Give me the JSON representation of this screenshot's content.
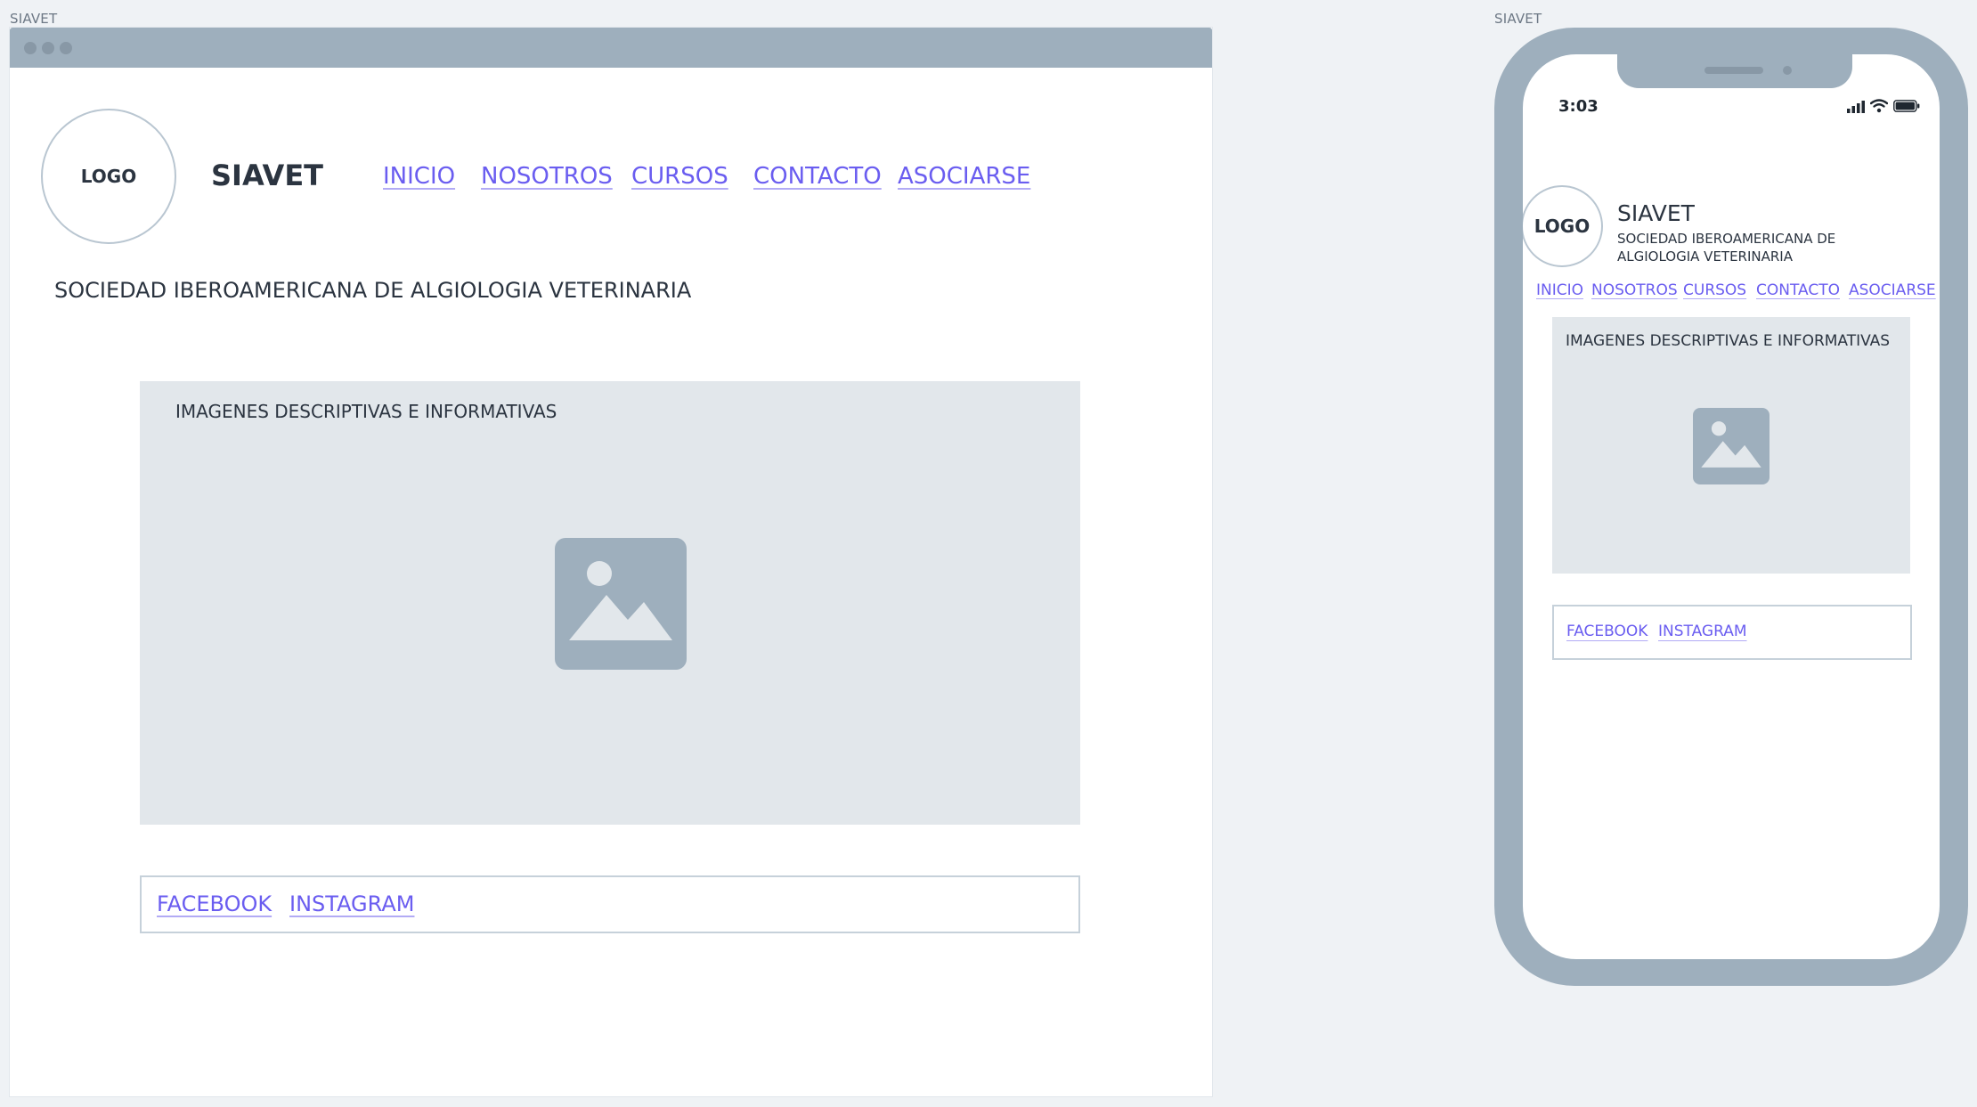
{
  "desktop": {
    "frame_label": "SIAVET",
    "logo_text": "LOGO",
    "brand": "SIAVET",
    "nav": [
      {
        "label": "INICIO"
      },
      {
        "label": "NOSOTROS"
      },
      {
        "label": "CURSOS"
      },
      {
        "label": "CONTACTO"
      },
      {
        "label": "ASOCIARSE"
      }
    ],
    "subtitle": "SOCIEDAD IBEROAMERICANA DE ALGIOLOGIA VETERINARIA",
    "image_panel_label": "IMAGENES DESCRIPTIVAS E INFORMATIVAS",
    "social": {
      "facebook": "FACEBOOK",
      "instagram": "INSTAGRAM"
    }
  },
  "mobile": {
    "frame_label": "SIAVET",
    "status_time": "3:03",
    "logo_text": "LOGO",
    "brand": "SIAVET",
    "subtitle": "SOCIEDAD IBEROAMERICANA DE ALGIOLOGIA VETERINARIA",
    "nav": [
      {
        "label": "INICIO"
      },
      {
        "label": "NOSOTROS"
      },
      {
        "label": "CURSOS"
      },
      {
        "label": "CONTACTO"
      },
      {
        "label": "ASOCIARSE"
      }
    ],
    "image_panel_label": "IMAGENES DESCRIPTIVAS E INFORMATIVAS",
    "social": {
      "facebook": "FACEBOOK",
      "instagram": "INSTAGRAM"
    }
  },
  "icons": {
    "image_placeholder": "image-placeholder-icon",
    "signal": "cellular-signal-icon",
    "wifi": "wifi-icon",
    "battery": "battery-icon"
  },
  "colors": {
    "link": "#6a5df0",
    "chrome": "#9eafbd",
    "panel": "#e2e7eb",
    "background": "#eff2f5"
  }
}
